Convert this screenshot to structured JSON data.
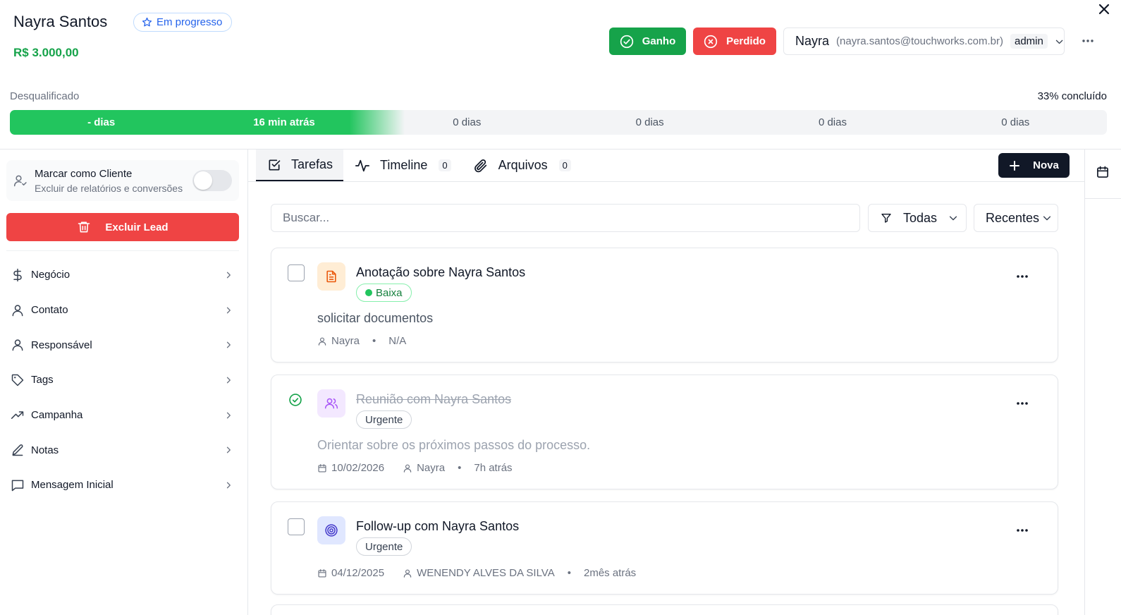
{
  "lead": {
    "name": "Nayra Santos",
    "status": "Em progresso",
    "value": "R$ 3.000,00"
  },
  "actions": {
    "won_label": "Ganho",
    "lost_label": "Perdido"
  },
  "owner": {
    "name": "Nayra",
    "email": "(nayra.santos@touchworks.com.br)",
    "role": "admin"
  },
  "pipeline": {
    "current_stage": "Desqualificado",
    "progress_text": "33% concluído",
    "progress_fraction": 0.33,
    "stages": [
      {
        "label": "- dias",
        "done": true
      },
      {
        "label": "16 min atrás",
        "done": true
      },
      {
        "label": "0 dias",
        "done": false
      },
      {
        "label": "0 dias",
        "done": false
      },
      {
        "label": "0 dias",
        "done": false
      },
      {
        "label": "0 dias",
        "done": false
      }
    ]
  },
  "sidebar": {
    "client_toggle": {
      "title": "Marcar como Cliente",
      "subtitle": "Excluir de relatórios e conversões",
      "checked": false
    },
    "delete_label": "Excluir Lead",
    "items": [
      {
        "label": "Negócio",
        "icon": "dollar-icon"
      },
      {
        "label": "Contato",
        "icon": "user-icon"
      },
      {
        "label": "Responsável",
        "icon": "user-icon"
      },
      {
        "label": "Tags",
        "icon": "tag-icon"
      },
      {
        "label": "Campanha",
        "icon": "trending-up-icon"
      },
      {
        "label": "Notas",
        "icon": "pen-icon"
      },
      {
        "label": "Mensagem Inicial",
        "icon": "message-icon"
      }
    ]
  },
  "tabs": [
    {
      "label": "Tarefas",
      "icon": "checkbox-icon",
      "count": null,
      "active": true
    },
    {
      "label": "Timeline",
      "icon": "activity-icon",
      "count": "0",
      "active": false
    },
    {
      "label": "Arquivos",
      "icon": "paperclip-icon",
      "count": "0",
      "active": false
    }
  ],
  "new_button_label": "Nova",
  "toolbar": {
    "search_placeholder": "Buscar...",
    "filter_value": "Todas",
    "sort_value": "Recentes"
  },
  "tasks": [
    {
      "title": "Anotação sobre Nayra Santos",
      "type_icon": "file-text-icon",
      "completed": false,
      "priority": "Baixa",
      "description": "solicitar documentos",
      "date": "",
      "assignee": "Nayra",
      "time": "N/A"
    },
    {
      "title": "Reunião com Nayra Santos",
      "type_icon": "users-icon",
      "completed": true,
      "priority": "Urgente",
      "description": "Orientar sobre os próximos passos do processo.",
      "date": "10/02/2026",
      "assignee": "Nayra",
      "time": "7h atrás"
    },
    {
      "title": "Follow-up com Nayra Santos",
      "type_icon": "target-icon",
      "completed": false,
      "priority": "Urgente",
      "description": "",
      "date": "04/12/2025",
      "assignee": "WENENDY ALVES DA SILVA",
      "time": "2mês atrás"
    }
  ],
  "colors": {
    "success": "#16a34a",
    "danger": "#ef4444",
    "accent_blue": "#2563eb",
    "dark": "#111827"
  }
}
